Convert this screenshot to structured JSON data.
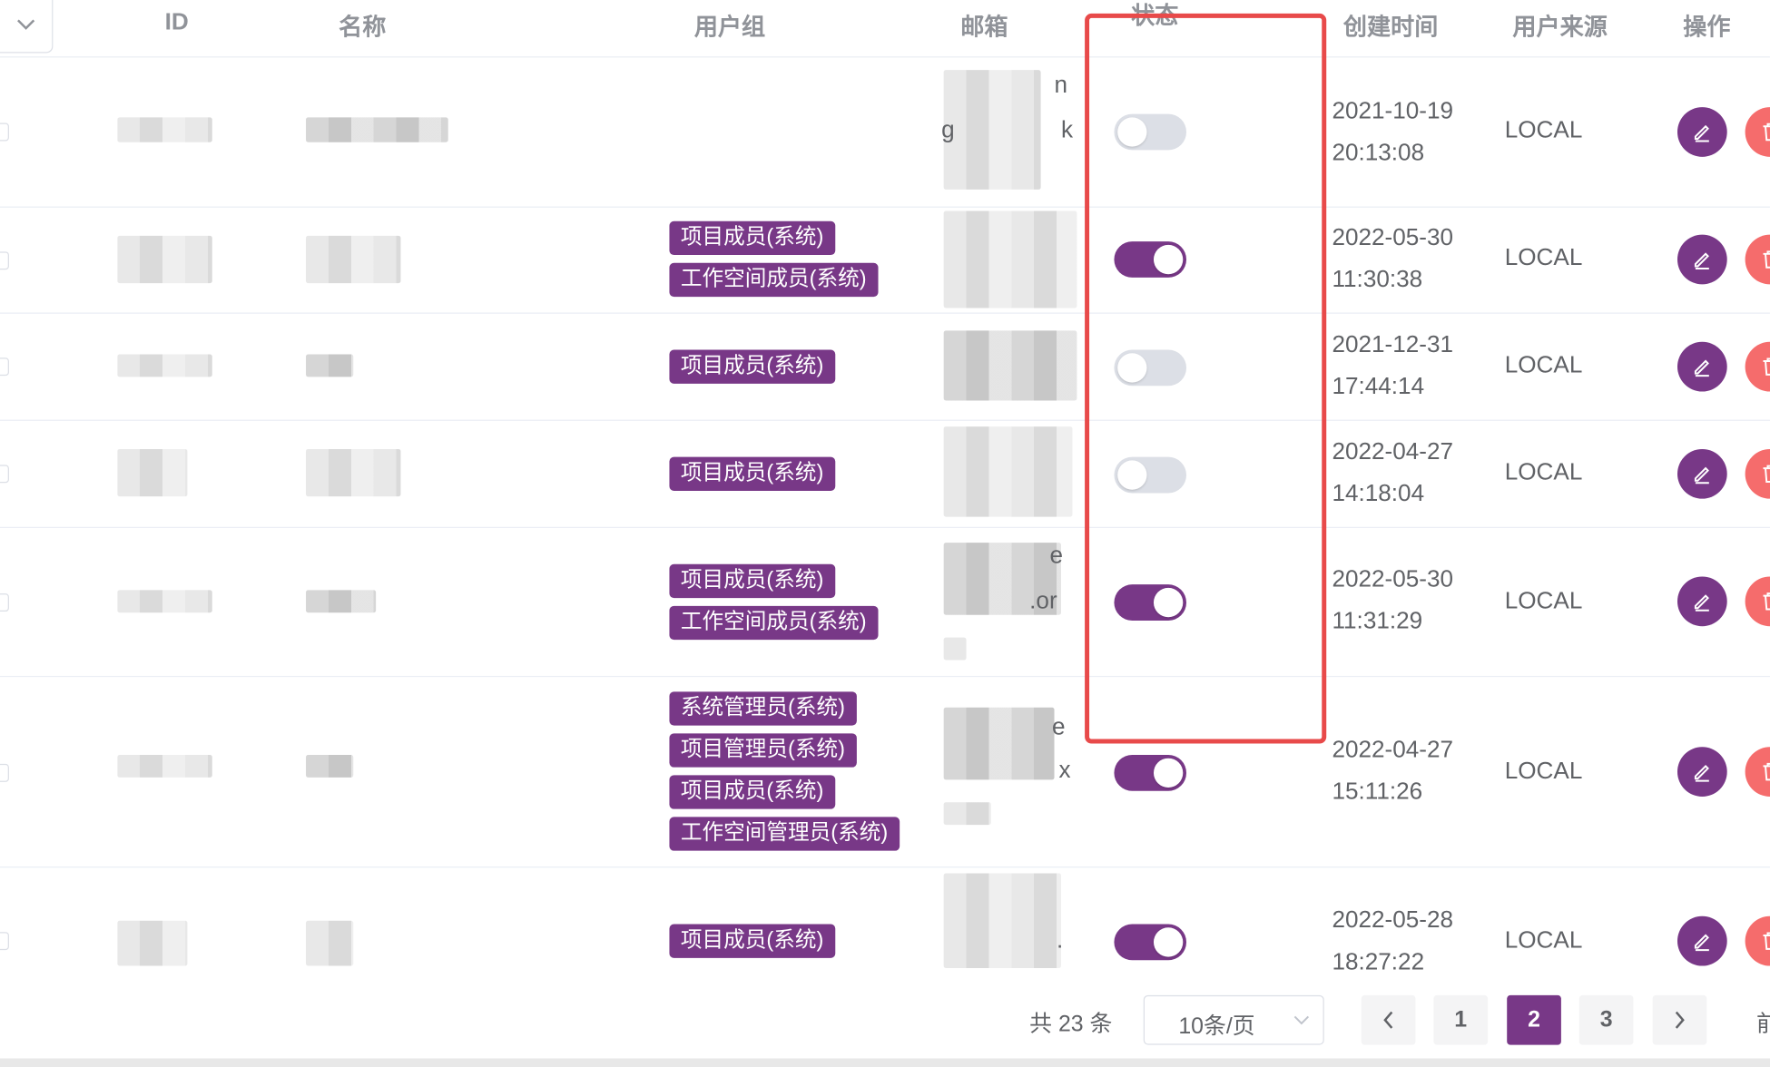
{
  "columns": {
    "id": "ID",
    "name": "名称",
    "user_group": "用户组",
    "email": "邮箱",
    "status": "状态",
    "created": "创建时间",
    "source": "用户来源",
    "actions": "操作"
  },
  "rows": [
    {
      "tags": [],
      "status": "off",
      "date": "2021-10-19",
      "time": "20:13:08",
      "source": "LOCAL",
      "email_frag_1": "n",
      "email_frag_2": "g",
      "email_frag_3": "k"
    },
    {
      "tags": [
        "项目成员(系统)",
        "工作空间成员(系统)"
      ],
      "status": "on",
      "date": "2022-05-30",
      "time": "11:30:38",
      "source": "LOCAL"
    },
    {
      "tags": [
        "项目成员(系统)"
      ],
      "status": "off",
      "date": "2021-12-31",
      "time": "17:44:14",
      "source": "LOCAL"
    },
    {
      "tags": [
        "项目成员(系统)"
      ],
      "status": "off",
      "date": "2022-04-27",
      "time": "14:18:04",
      "source": "LOCAL"
    },
    {
      "tags": [
        "项目成员(系统)",
        "工作空间成员(系统)"
      ],
      "status": "on",
      "date": "2022-05-30",
      "time": "11:31:29",
      "source": "LOCAL",
      "email_frag_1": "e",
      "email_frag_2": ".or"
    },
    {
      "tags": [
        "系统管理员(系统)",
        "项目管理员(系统)",
        "项目成员(系统)",
        "工作空间管理员(系统)"
      ],
      "status": "on",
      "date": "2022-04-27",
      "time": "15:11:26",
      "source": "LOCAL",
      "email_frag_1": "e",
      "email_frag_2": "x"
    },
    {
      "tags": [
        "项目成员(系统)"
      ],
      "status": "on",
      "date": "2022-05-28",
      "time": "18:27:22",
      "source": "LOCAL",
      "email_frag_1": "."
    }
  ],
  "pagination": {
    "total": "共 23 条",
    "page_size": "10条/页",
    "pages": [
      "1",
      "2",
      "3"
    ],
    "current": "2",
    "jump_label": "前"
  },
  "colors": {
    "brand": "#783887",
    "danger": "#f56c6c",
    "highlight": "#e84a4a"
  },
  "icons": {
    "edit": "pencil-icon",
    "delete": "trash-icon",
    "prev": "chevron-left-icon",
    "next": "chevron-right-icon",
    "dropdown": "chevron-down-icon"
  }
}
